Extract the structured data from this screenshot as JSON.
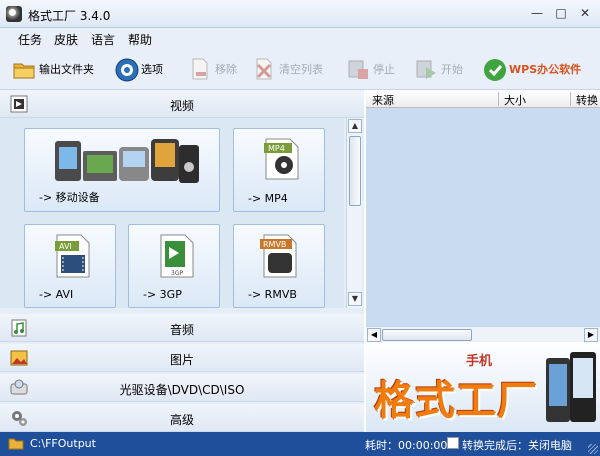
{
  "window": {
    "title": "格式工厂 3.4.0",
    "minimize": "—",
    "maximize": "□",
    "close": "✕"
  },
  "menu": [
    "任务",
    "皮肤",
    "语言",
    "帮助"
  ],
  "toolbar": {
    "output_folder": "输出文件夹",
    "options": "选项",
    "remove": "移除",
    "clear_list": "清空列表",
    "stop": "停止",
    "start": "开始",
    "wps": "WPS办公软件"
  },
  "categories": {
    "video": "视频",
    "audio": "音频",
    "image": "图片",
    "disc": "光驱设备\\DVD\\CD\\ISO",
    "advanced": "高级"
  },
  "video_tiles": [
    {
      "label": "-> 移动设备",
      "icon": "mobile-devices-icon"
    },
    {
      "label": "-> MP4",
      "icon": "mp4-file-icon",
      "badge": "MP4"
    },
    {
      "label": "-> AVI",
      "icon": "avi-file-icon",
      "badge": "AVI"
    },
    {
      "label": "-> 3GP",
      "icon": "3gp-file-icon",
      "badge": "3GP"
    },
    {
      "label": "-> RMVB",
      "icon": "rmvb-file-icon",
      "badge": "RMVB"
    }
  ],
  "task_list": {
    "columns": [
      "来源",
      "大小",
      "转换"
    ]
  },
  "scroll": {
    "up": "▲",
    "down": "▼",
    "left": "◀",
    "right": "▶"
  },
  "banner": {
    "title": "格式工厂",
    "small": "手机"
  },
  "status": {
    "output_path": "C:\\FFOutput",
    "elapsed": "耗时：00:00:00",
    "after_convert": "转换完成后：关闭电脑"
  },
  "colors": {
    "accent": "#1f4e9a",
    "panel": "#e5edf7",
    "tile_border": "#9fbfe2",
    "banner_orange": "#f07c10"
  }
}
